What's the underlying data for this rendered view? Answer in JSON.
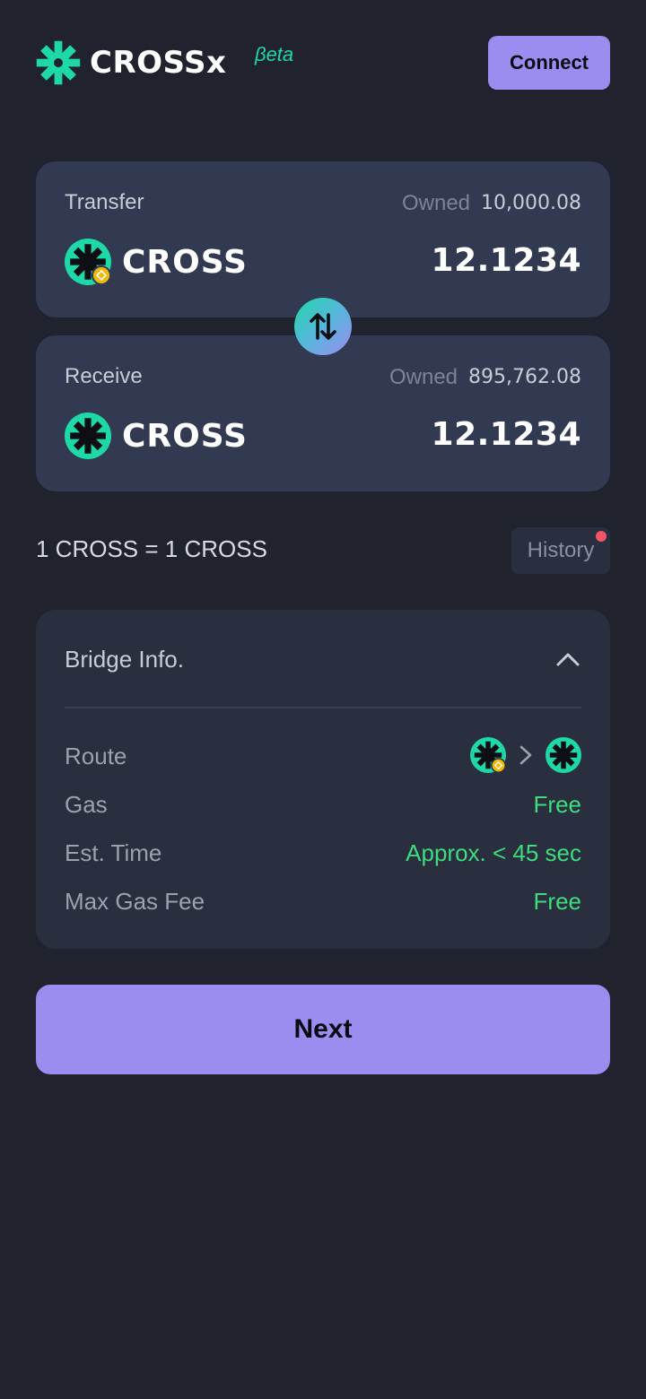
{
  "header": {
    "logo_text": "CROSSx",
    "beta_label": "βeta",
    "connect_label": "Connect"
  },
  "transfer": {
    "label": "Transfer",
    "owned_label": "Owned",
    "owned_value": "10,000.08",
    "token_name": "CROSS",
    "token_icon": "cross-token-icon",
    "chain_badge_icon": "bnb-chain-badge-icon",
    "amount": "12.1234"
  },
  "receive": {
    "label": "Receive",
    "owned_label": "Owned",
    "owned_value": "895,762.08",
    "token_name": "CROSS",
    "token_icon": "cross-token-icon",
    "amount": "12.1234"
  },
  "swap_icon": "swap-arrows-icon",
  "rate_text": "1 CROSS = 1 CROSS",
  "history": {
    "label": "History",
    "has_notification": true
  },
  "bridge_info": {
    "title": "Bridge Info.",
    "expanded": true,
    "rows": [
      {
        "key": "Route",
        "value": ""
      },
      {
        "key": "Gas",
        "value": "Free"
      },
      {
        "key": "Est. Time",
        "value": "Approx. < 45 sec"
      },
      {
        "key": "Max Gas Fee",
        "value": "Free"
      }
    ]
  },
  "next_label": "Next",
  "colors": {
    "background": "#20232e",
    "card": "#313a51",
    "panel": "#2a2f3f",
    "accent": "#9b8cf0",
    "brand_green": "#1fd8a8",
    "success": "#3ddc7e",
    "notification": "#f25563",
    "bnb": "#f0b90b"
  }
}
